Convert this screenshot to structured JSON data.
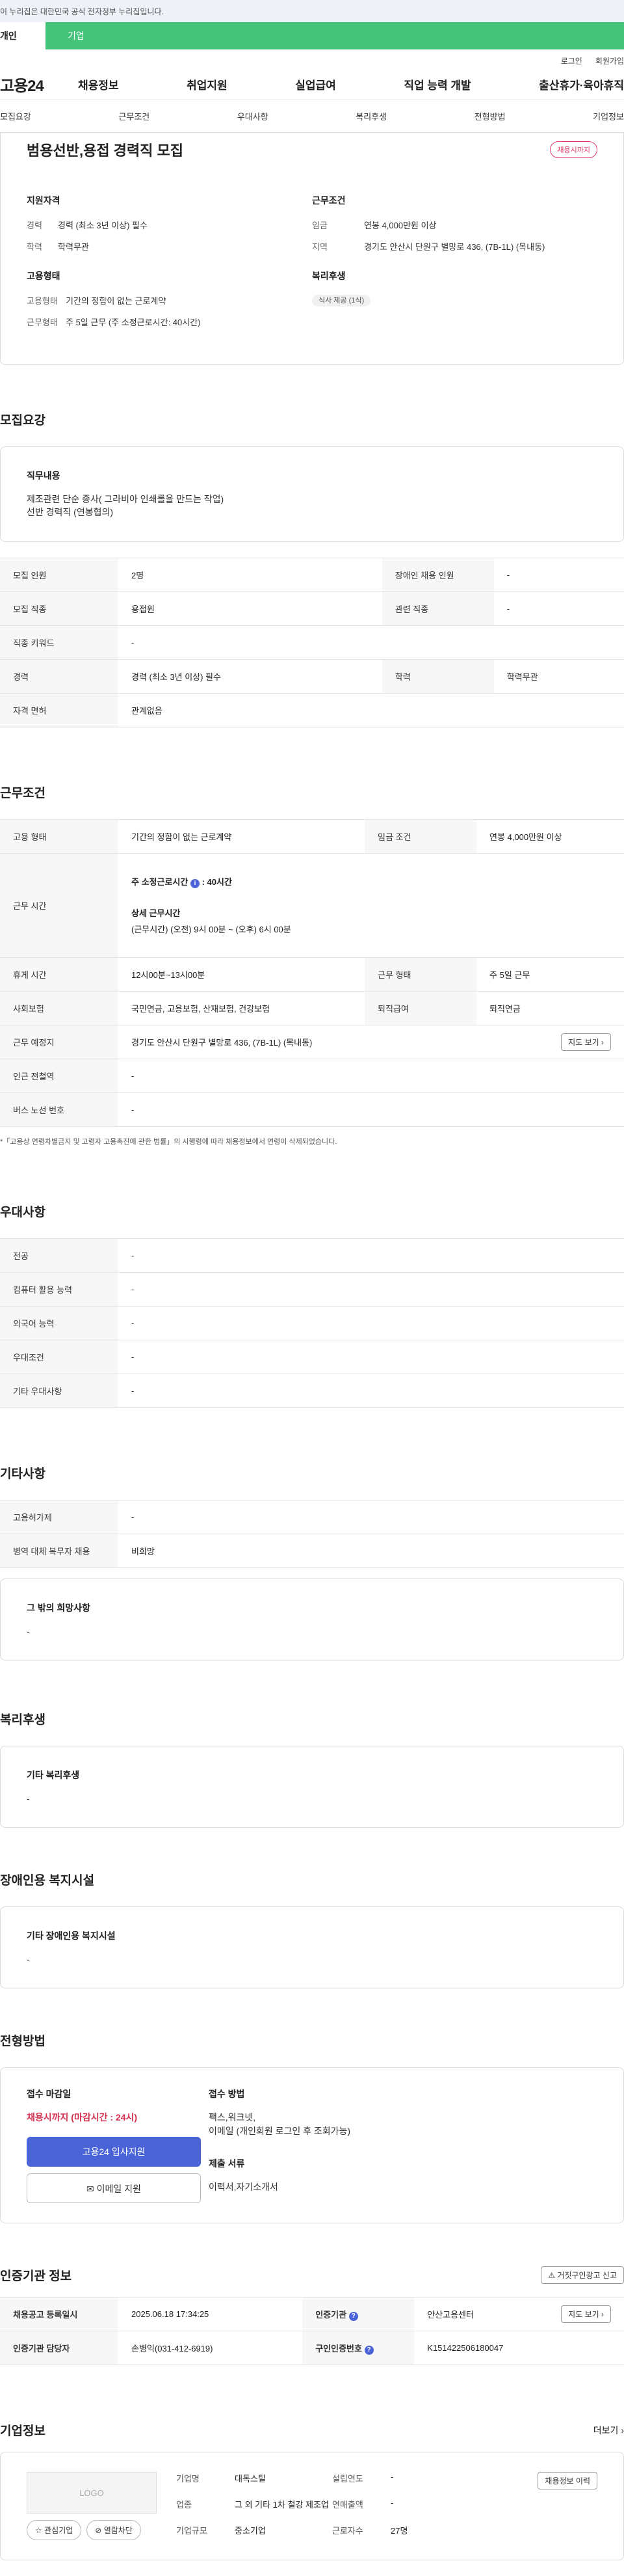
{
  "gov_notice": "이 누리집은 대한민국 공식 전자정부 누리집입니다.",
  "tabs": {
    "individual": "개인",
    "company": "기업"
  },
  "util": {
    "login": "로그인",
    "join": "회원가입"
  },
  "logo": "고용24",
  "gnb": [
    "채용정보",
    "취업지원",
    "실업급여",
    "직업 능력 개발",
    "출산휴가·육아휴직"
  ],
  "subnav": [
    "모집요강",
    "근무조건",
    "우대사항",
    "복리후생",
    "전형방법",
    "기업정보"
  ],
  "head": {
    "title": "범용선반,용접 경력직 모집",
    "badge": "채용시까지",
    "qual_h": "지원자격",
    "qual": [
      {
        "k": "경력",
        "v": "경력 (최소 3년 이상) 필수"
      },
      {
        "k": "학력",
        "v": "학력무관"
      }
    ],
    "emp_h": "고용형태",
    "emp": [
      {
        "k": "고용형태",
        "v": "기간의 정함이 없는 근로계약"
      },
      {
        "k": "근무형태",
        "v": "주 5일 근무 (주 소정근로시간: 40시간)"
      }
    ],
    "cond_h": "근무조건",
    "cond": [
      {
        "k": "임금",
        "v": "연봉 4,000만원 이상"
      },
      {
        "k": "지역",
        "v": "경기도 안산시 단원구 별망로 436, (7B-1L) (목내동)"
      }
    ],
    "welfare_h": "복리후생",
    "welfare_chip": "식사 제공 (1식)"
  },
  "recruit": {
    "title": "모집요강",
    "duty_h": "직무내용",
    "duty_t1": "제조관련 단순 종사( 그라비아 인쇄롤을 만드는 작업)",
    "duty_t2": "선반 경력직 (연봉협의)",
    "rows": [
      {
        "k1": "모집 인원",
        "v1": "2명",
        "k2": "장애인 채용 인원",
        "v2": "-"
      },
      {
        "k1": "모집 직종",
        "v1": "용접원",
        "k2": "관련 직종",
        "v2": "-"
      },
      {
        "k1": "직종 키워드",
        "v1": "-"
      },
      {
        "k1": "경력",
        "v1": "경력 (최소 3년 이상) 필수",
        "k2": "학력",
        "v2": "학력무관"
      },
      {
        "k1": "자격 면허",
        "v1": "관계없음"
      }
    ]
  },
  "work": {
    "title": "근무조건",
    "r1": {
      "k1": "고용 형태",
      "v1": "기간의 정함이 없는 근로계약",
      "k2": "임금 조건",
      "v2": "연봉 4,000만원 이상"
    },
    "hours_k": "근무 시간",
    "hours_line1_a": "주 소정근로시간",
    "hours_line1_b": "40시간",
    "hours_h2": "상세 근무시간",
    "hours_detail": "(근무시간) (오전) 9시 00분 ~ (오후) 6시 00분",
    "r3": {
      "k1": "휴게 시간",
      "v1": "12시00분~13시00분",
      "k2": "근무 형태",
      "v2": "주 5일 근무"
    },
    "r4": {
      "k1": "사회보험",
      "v1": "국민연금, 고용보험, 산재보험, 건강보험",
      "k2": "퇴직급여",
      "v2": "퇴직연금"
    },
    "r5": {
      "k1": "근무 예정지",
      "v1": "경기도 안산시 단원구 별망로 436, (7B-1L) (목내동)",
      "btn": "지도 보기"
    },
    "r6": {
      "k1": "인근 전철역",
      "v1": "-"
    },
    "r7": {
      "k1": "버스 노선 번호",
      "v1": "-"
    },
    "note": "*「고용상 연령차별금지 및 고령자 고용촉진에 관한 법률」의 시행령에 따라 채용정보에서 연령이 삭제되었습니다."
  },
  "pref": {
    "title": "우대사항",
    "rows": [
      {
        "k": "전공",
        "v": "-"
      },
      {
        "k": "컴퓨터 활용 능력",
        "v": "-"
      },
      {
        "k": "외국어 능력",
        "v": "-"
      },
      {
        "k": "우대조건",
        "v": "-"
      },
      {
        "k": "기타 우대사항",
        "v": "-"
      }
    ]
  },
  "etc": {
    "title": "기타사항",
    "rows": [
      {
        "k": "고용허가제",
        "v": "-"
      },
      {
        "k": "병역 대체 복무자 채용",
        "v": "비희망"
      }
    ],
    "other_h": "그 밖의 희망사항",
    "other_t": "-"
  },
  "welfare": {
    "title": "복리후생",
    "h": "기타 복리후생",
    "t": "-"
  },
  "disab": {
    "title": "장애인용 복지시설",
    "h": "기타 장애인용 복지시설",
    "t": "-"
  },
  "process": {
    "title": "전형방법",
    "deadline_h": "접수 마감일",
    "deadline_v": "채용시까지 (마감시간 : 24시)",
    "btn_apply": "고용24 입사지원",
    "btn_email": "이메일 지원",
    "method_h": "접수 방법",
    "method_v1": "팩스,워크넷,",
    "method_v2": "이메일 (개인회원 로그인 후 조회가능)",
    "docs_h": "제출 서류",
    "docs_v": "이력서,자기소개서"
  },
  "cert": {
    "title": "인증기관 정보",
    "report_btn": "거짓구인광고 신고",
    "r1": {
      "k1": "채용공고 등록일시",
      "v1": "2025.06.18 17:34:25",
      "k2": "인증기관",
      "v2": "안산고용센터",
      "btn": "지도 보기"
    },
    "r2": {
      "k1": "인증기관 담당자",
      "v1": "손병익(031-412-6919)",
      "k2": "구인인증번호",
      "v2": "K151422506180047"
    }
  },
  "company": {
    "title": "기업정보",
    "more": "더보기",
    "logo_text": "LOGO",
    "btn_fav": "관심기업",
    "btn_block": "열람차단",
    "btn_history": "채용정보 이력",
    "name_k": "기업명",
    "name_v": "대독스틸",
    "industry_k": "업종",
    "industry_v": "그 외 기타 1차 철강 제조업",
    "size_k": "기업규모",
    "size_v": "중소기업",
    "year_k": "설립연도",
    "year_v": "-",
    "sales_k": "연매출액",
    "sales_v": "-",
    "emp_k": "근로자수",
    "emp_v": "27명"
  }
}
